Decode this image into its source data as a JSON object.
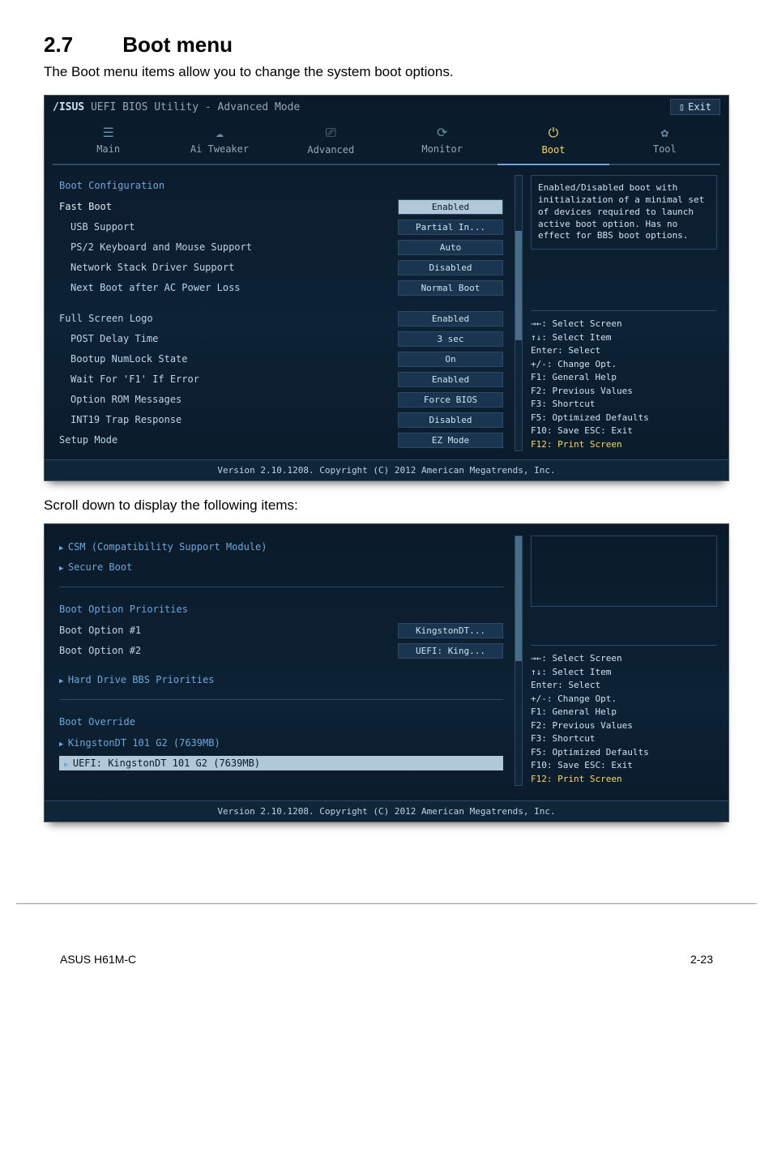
{
  "heading_num": "2.7",
  "heading_text": "Boot menu",
  "intro": "The Boot menu items allow you to change the system boot options.",
  "midtext": "Scroll down to display the following items:",
  "footer_left": "ASUS H61M-C",
  "footer_right": "2-23",
  "bios": {
    "title": "UEFI BIOS Utility - Advanced Mode",
    "exit": "Exit",
    "tabs": [
      "Main",
      "Ai Tweaker",
      "Advanced",
      "Monitor",
      "Boot",
      "Tool"
    ],
    "active_tab": 4,
    "help_text": "Enabled/Disabled boot with initialization of a minimal set of devices required to launch active boot option. Has no effect for BBS boot options.",
    "section_title": "Boot Configuration",
    "rows": [
      {
        "label": "Fast Boot",
        "value": "Enabled",
        "selected": true,
        "top": true
      },
      {
        "label": "USB Support",
        "value": "Partial In..."
      },
      {
        "label": "PS/2 Keyboard and Mouse Support",
        "value": "Auto"
      },
      {
        "label": "Network Stack Driver Support",
        "value": "Disabled"
      },
      {
        "label": "Next Boot after AC Power Loss",
        "value": "Normal Boot"
      }
    ],
    "rows2": [
      {
        "label": "Full Screen Logo",
        "value": "Enabled",
        "top": true
      },
      {
        "label": "POST Delay Time",
        "value": "3 sec"
      },
      {
        "label": "Bootup NumLock State",
        "value": "On"
      },
      {
        "label": "Wait For 'F1' If Error",
        "value": "Enabled"
      },
      {
        "label": "Option ROM Messages",
        "value": "Force BIOS"
      },
      {
        "label": "INT19 Trap Response",
        "value": "Disabled"
      },
      {
        "label": "Setup Mode",
        "value": "EZ Mode",
        "top": true
      }
    ],
    "keys": [
      "→←: Select Screen",
      "↑↓: Select Item",
      "Enter: Select",
      "+/-: Change Opt.",
      "F1: General Help",
      "F2: Previous Values",
      "F3: Shortcut",
      "F5: Optimized Defaults",
      "F10: Save   ESC: Exit",
      "F12: Print Screen"
    ],
    "copyright": "Version 2.10.1208. Copyright (C) 2012 American Megatrends, Inc."
  },
  "bios2": {
    "links_top": [
      "CSM (Compatibility Support Module)",
      "Secure Boot"
    ],
    "priorities_title": "Boot Option Priorities",
    "opts": [
      {
        "label": "Boot Option #1",
        "value": "KingstonDT..."
      },
      {
        "label": "Boot Option #2",
        "value": "UEFI: King..."
      }
    ],
    "hdd_link": "Hard Drive BBS Priorities",
    "override_title": "Boot Override",
    "override_items": [
      "KingstonDT 101 G2  (7639MB)",
      "UEFI: KingstonDT 101 G2 (7639MB)"
    ],
    "keys": [
      "→←: Select Screen",
      "↑↓: Select Item",
      "Enter: Select",
      "+/-: Change Opt.",
      "F1: General Help",
      "F2: Previous Values",
      "F3: Shortcut",
      "F5: Optimized Defaults",
      "F10: Save   ESC: Exit",
      "F12: Print Screen"
    ],
    "copyright": "Version 2.10.1208. Copyright (C) 2012 American Megatrends, Inc."
  }
}
